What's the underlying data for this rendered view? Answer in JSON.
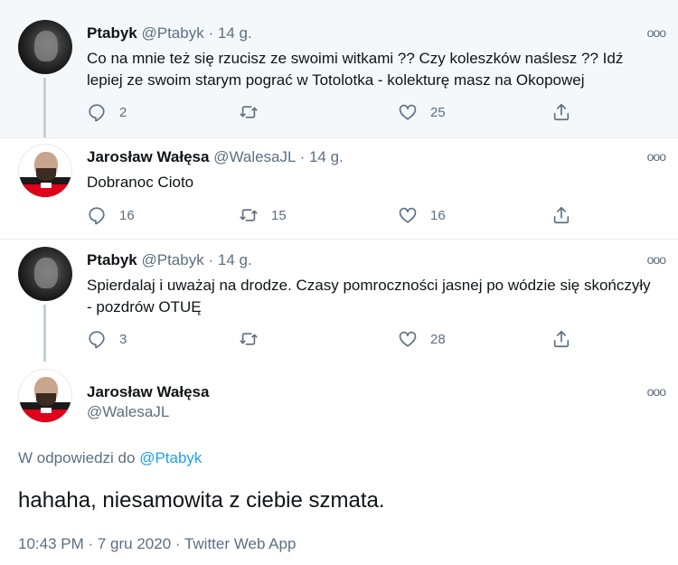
{
  "replies": [
    {
      "name": "Ptabyk",
      "handle": "@Ptabyk",
      "separator": "·",
      "time": "14 g.",
      "text": "Co na mnie też się rzucisz ze swoimi witkami ?? Czy koleszków naślesz ?? Idź lepiej ze swoim starym pograć w Totolotka - kolekturę masz na Okopowej",
      "reply_count": "2",
      "retweet_count": "",
      "like_count": "25"
    },
    {
      "name": "Jarosław Wałęsa",
      "handle": "@WalesaJL",
      "separator": "·",
      "time": "14 g.",
      "text": "Dobranoc Cioto",
      "reply_count": "16",
      "retweet_count": "15",
      "like_count": "16"
    },
    {
      "name": "Ptabyk",
      "handle": "@Ptabyk",
      "separator": "·",
      "time": "14 g.",
      "text": "Spierdalaj i uważaj na drodze. Czasy pomroczności jasnej po wódzie się skończyły - pozdrów OTUĘ",
      "reply_count": "3",
      "retweet_count": "",
      "like_count": "28"
    }
  ],
  "main_tweet": {
    "name": "Jarosław Wałęsa",
    "handle": "@WalesaJL",
    "reply_prefix": "W odpowiedzi do",
    "reply_to": "@Ptabyk",
    "text": "hahaha, niesamowita z ciebie szmata.",
    "meta": "10:43 PM · 7 gru 2020 · Twitter Web App"
  },
  "more_label": "ooo",
  "icons": {
    "reply": "reply-icon",
    "retweet": "retweet-icon",
    "like": "heart-icon",
    "share": "share-icon"
  },
  "colors": {
    "accent": "#1da1f2",
    "secondary_text": "#5b7083",
    "highlight_bg": "#f5f8fa"
  }
}
